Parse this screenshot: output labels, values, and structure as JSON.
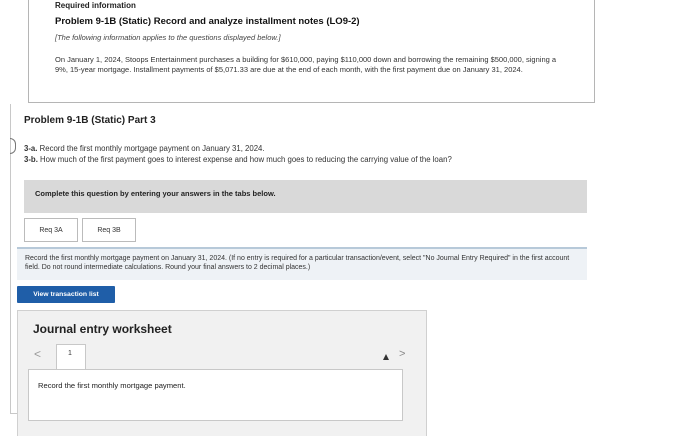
{
  "info": {
    "required_information": "Required information",
    "problem_title": "Problem 9-1B (Static) Record and analyze installment notes (LO9-2)",
    "note": "[The following information applies to the questions displayed below.]",
    "description": "On January 1, 2024, Stoops Entertainment purchases a building for $610,000, paying $110,000 down and borrowing the remaining $500,000, signing a 9%, 15-year mortgage. Installment payments of $5,071.33 are due at the end of each month, with the first payment due on January 31, 2024."
  },
  "part": {
    "title": "Problem 9-1B (Static) Part 3",
    "q3a_tag": "3-a.",
    "q3a_text": " Record the first monthly mortgage payment on January 31, 2024.",
    "q3b_tag": "3-b.",
    "q3b_text": " How much of the first payment goes to interest expense and how much goes to reducing the carrying value of the loan?"
  },
  "banner": {
    "text": "Complete this question by entering your answers in the tabs below."
  },
  "tabs": [
    {
      "label": "Req 3A"
    },
    {
      "label": "Req 3B"
    }
  ],
  "instructions": "Record the first monthly mortgage payment on January 31, 2024. (If no entry is required for a particular transaction/event, select \"No Journal Entry Required\" in the first account field. Do not round intermediate calculations. Round your final answers to 2 decimal places.)",
  "view_button": "View transaction list",
  "worksheet": {
    "title": "Journal entry worksheet",
    "prev": "<",
    "page": "1",
    "next": ">",
    "entry_label": "Record the first monthly mortgage payment."
  }
}
